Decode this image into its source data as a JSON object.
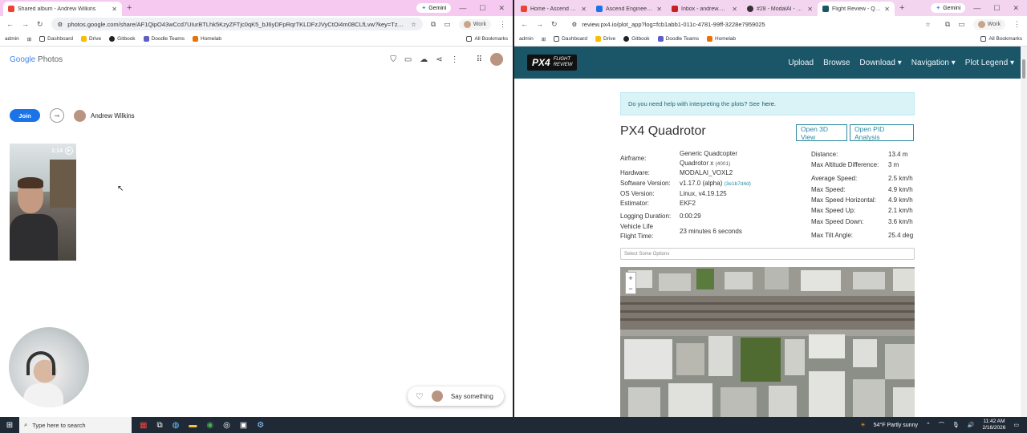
{
  "left_window": {
    "tabs": [
      {
        "title": "Shared album - Andrew Wilkins",
        "active": true
      }
    ],
    "gemini_label": "Gemini",
    "url": "photos.google.com/share/AF1QipO43wCcd7UIurBTLhk5KzyZFTjc0qK5_bJ6yDFpRqrTKLDFzJVyCtOi4m08CLfLvw?key=TzRHSERma...",
    "profile_label": "Work",
    "bookmarks": [
      "admin",
      "Dashboard",
      "Drive",
      "Gitbook",
      "Doodle Teams",
      "Homelab"
    ],
    "all_bookmarks": "All Bookmarks"
  },
  "photos": {
    "logo_google": "Google",
    "logo_photos": "Photos",
    "join_label": "Join",
    "owner_name": "Andrew Wilkins",
    "video_duration": "1:14",
    "comment_placeholder": "Say something"
  },
  "right_window": {
    "tabs": [
      {
        "title": "Home - Ascend Engin",
        "active": false
      },
      {
        "title": "Ascend Engineering",
        "active": false
      },
      {
        "title": "Inbox - andrew.wilkin",
        "active": false
      },
      {
        "title": "#28 - ModalAI - Fligh",
        "active": false
      },
      {
        "title": "Flight Review - Quad",
        "active": true
      }
    ],
    "gemini_label": "Gemini",
    "url": "review.px4.io/plot_app?log=fcb1abb1-011c-4781-99ff-3228e7959025",
    "profile_label": "Work",
    "bookmarks": [
      "admin",
      "Dashboard",
      "Drive",
      "Gitbook",
      "Doodle Teams",
      "Homelab"
    ],
    "all_bookmarks": "All Bookmarks"
  },
  "px4": {
    "logo_main": "PX4",
    "logo_sub1": "FLIGHT",
    "logo_sub2": "REVIEW",
    "nav": [
      "Upload",
      "Browse",
      "Download",
      "Navigation",
      "Plot Legend"
    ],
    "help_text": "Do you need help with interpreting the plots? See",
    "help_link": "here.",
    "title": "PX4 Quadrotor",
    "btn_3d": "Open 3D View",
    "btn_pid": "Open PID Analysis",
    "airframe_label": "Airframe:",
    "airframe_value1": "Generic Quadcopter",
    "airframe_value2": "Quadrotor x",
    "airframe_id": "(4001)",
    "hardware_label": "Hardware:",
    "hardware_value": "MODALAI_VOXL2",
    "software_label": "Software Version:",
    "software_value": "v1.17.0 (alpha)",
    "software_hash": "(3e1b7d4d)",
    "os_label": "OS Version:",
    "os_value": "Linux, v4.19.125",
    "estimator_label": "Estimator:",
    "estimator_value": "EKF2",
    "logging_label": "Logging Duration:",
    "logging_value": "0:00:29",
    "vlft_label1": "Vehicle Life",
    "vlft_label2": "Flight Time:",
    "vlft_value": "23 minutes 6 seconds",
    "stats": [
      {
        "label": "Distance:",
        "value": "13.4 m"
      },
      {
        "label": "Max Altitude Difference:",
        "value": "3 m"
      },
      {
        "label": "Average Speed:",
        "value": "2.5 km/h"
      },
      {
        "label": "Max Speed:",
        "value": "4.9 km/h"
      },
      {
        "label": "Max Speed Horizontal:",
        "value": "4.9 km/h"
      },
      {
        "label": "Max Speed Up:",
        "value": "2.1 km/h"
      },
      {
        "label": "Max Speed Down:",
        "value": "3.6 km/h"
      },
      {
        "label": "Max Tilt Angle:",
        "value": "25.4 deg"
      }
    ],
    "select_placeholder": "Select Some Options",
    "zoom_in": "+",
    "zoom_out": "−"
  },
  "taskbar": {
    "search_placeholder": "Type here to search",
    "weather": "54°F  Partly sunny",
    "time": "11:42 AM",
    "date": "2/16/2026"
  }
}
